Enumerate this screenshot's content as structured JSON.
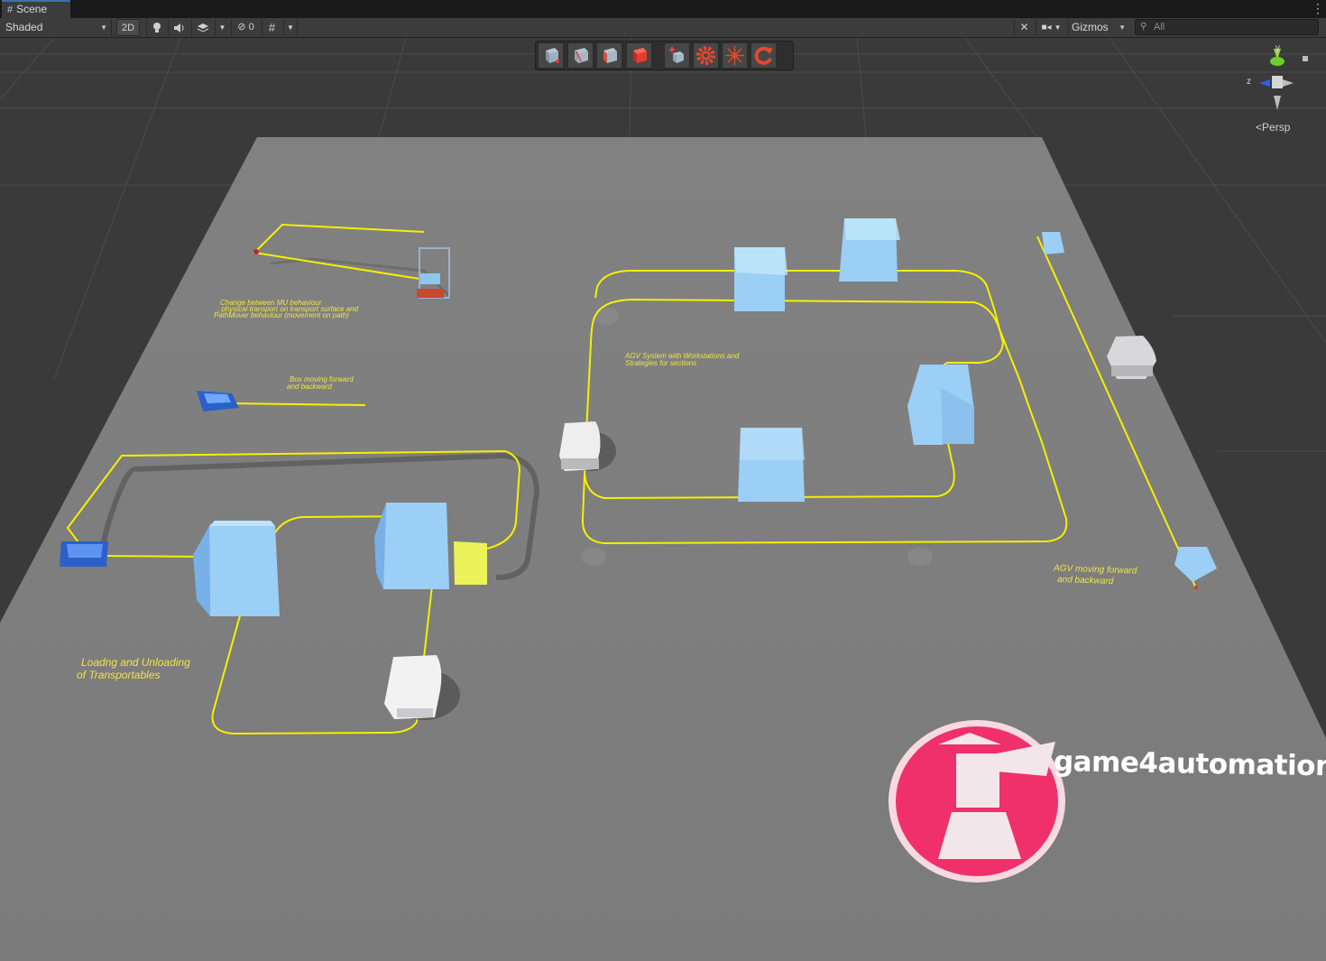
{
  "tab": {
    "icon": "grid-hash-icon",
    "label": "Scene"
  },
  "toolbar": {
    "draw_mode": "Shaded",
    "toggle_2d": "2D",
    "hidden_count": "0",
    "gizmos_label": "Gizmos",
    "search_placeholder": "All"
  },
  "tool_handles": [
    "view-tool-cube-icon",
    "move-cube-icon",
    "rotate-cube-icon",
    "scale-cube-red-icon",
    "add-sensor-icon",
    "settings-gear-icon",
    "drive-spark-icon",
    "refresh-arrow-icon"
  ],
  "orientation_gizmo": {
    "y": "y",
    "z": "z",
    "projection": "Persp"
  },
  "scene_labels": {
    "change_behaviour_1": "Change between MU behaviour",
    "change_behaviour_2": ", physical transport on transport surface and",
    "change_behaviour_3": "PathMover behaviour (movement on path)",
    "box_moving_1": "Box moving forward",
    "box_moving_2": "and backward",
    "agv_system_1": "AGV System with Workstations and",
    "agv_system_2": "Strategies for sections",
    "agv_moving_1": "AGV  moving forward",
    "agv_moving_2": "and backward",
    "loading_1": "Loadng and Unloading",
    "loading_2": "of Transportables",
    "brand": "game4automation"
  },
  "colors": {
    "floor": "#7f7f7f",
    "path": "#f5f000",
    "workstation": "#7fc1f0",
    "logo": "#f0306a",
    "sky": "#3a3a3a"
  }
}
